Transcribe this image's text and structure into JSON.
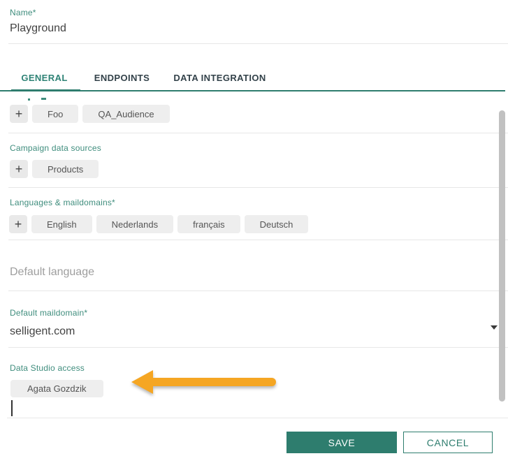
{
  "dialog": {
    "name_field": {
      "label": "Name*",
      "value": "Playground"
    },
    "tabs": {
      "general": "GENERAL",
      "endpoints": "ENDPOINTS",
      "data_integration": "DATA INTEGRATION",
      "active_tab": "GENERAL"
    },
    "add_button_glyph": "+",
    "audience_row": {
      "chips": [
        "Foo",
        "QA_Audience"
      ]
    },
    "campaign_data_sources": {
      "label": "Campaign data sources",
      "chips": [
        "Products"
      ]
    },
    "languages_maildomains": {
      "label": "Languages & maildomains*",
      "chips": [
        "English",
        "Nederlands",
        "français",
        "Deutsch"
      ]
    },
    "default_language": {
      "placeholder": "Default language",
      "value": ""
    },
    "default_maildomain": {
      "label": "Default maildomain*",
      "value": "selligent.com"
    },
    "data_studio_access": {
      "label": "Data Studio access",
      "chips": [
        "Agata Gozdzik"
      ]
    },
    "footer": {
      "save": "SAVE",
      "cancel": "CANCEL"
    }
  },
  "annotation": {
    "arrow_direction": "left",
    "arrow_color": "#f5a623",
    "points_at": "Agata Gozdzik chip"
  },
  "colors": {
    "accent_teal": "#2e7d6e",
    "label_teal": "#3f8d7d",
    "tab_inactive_text": "#33424a",
    "chip_bg": "#eeeeee",
    "chip_text": "#555555",
    "placeholder_gray": "#9e9e9e",
    "divider": "#e7e7e7",
    "scrollbar": "#c1c1c1"
  }
}
